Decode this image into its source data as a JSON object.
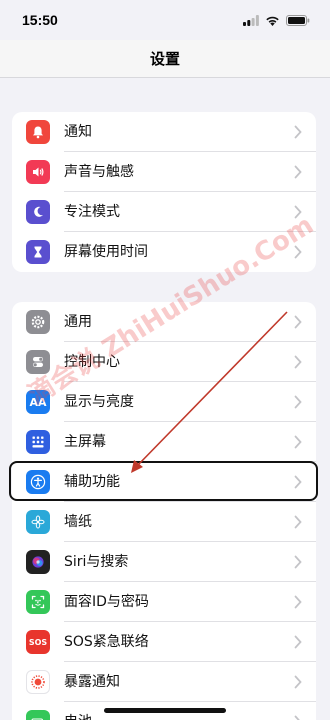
{
  "status_bar": {
    "time": "15:50"
  },
  "nav": {
    "title": "设置"
  },
  "group1": [
    {
      "label": "通知",
      "icon": "bell-icon",
      "color": "#f0463c"
    },
    {
      "label": "声音与触感",
      "icon": "speaker-icon",
      "color": "#f23a55"
    },
    {
      "label": "专注模式",
      "icon": "moon-icon",
      "color": "#5a4fcf"
    },
    {
      "label": "屏幕使用时间",
      "icon": "hourglass-icon",
      "color": "#5a4fcf"
    }
  ],
  "group2": [
    {
      "label": "通用",
      "icon": "gear-icon",
      "color": "#8e8e93"
    },
    {
      "label": "控制中心",
      "icon": "toggles-icon",
      "color": "#8e8e93"
    },
    {
      "label": "显示与亮度",
      "icon": "text-size-icon",
      "color": "#1a7cf0",
      "glyph": "AA"
    },
    {
      "label": "主屏幕",
      "icon": "home-grid-icon",
      "color": "#2f5fe0"
    },
    {
      "label": "辅助功能",
      "icon": "accessibility-icon",
      "color": "#1a7cf0"
    },
    {
      "label": "墙纸",
      "icon": "flower-icon",
      "color": "#2aa8d8"
    },
    {
      "label": "Siri与搜索",
      "icon": "siri-icon",
      "color": "#222222"
    },
    {
      "label": "面容ID与密码",
      "icon": "faceid-icon",
      "color": "#34c759"
    },
    {
      "label": "SOS紧急联络",
      "icon": "sos-icon",
      "color": "#e8352d",
      "glyph": "SOS"
    },
    {
      "label": "暴露通知",
      "icon": "exposure-icon",
      "color": "#ffffff"
    },
    {
      "label": "电池",
      "icon": "battery-icon",
      "color": "#34c759"
    }
  ],
  "watermark": {
    "text": "滴会说 ZhiHuiShuo.Com"
  }
}
